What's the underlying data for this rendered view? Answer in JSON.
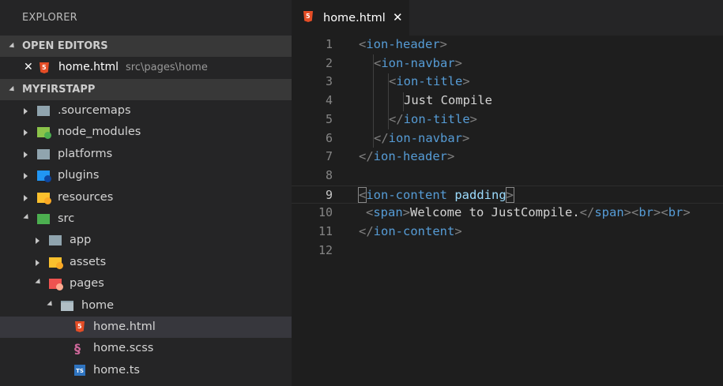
{
  "sidebar": {
    "title": "EXPLORER",
    "open_editors": {
      "header": "OPEN EDITORS",
      "items": [
        {
          "name": "home.html",
          "desc": "src\\pages\\home",
          "icon": "html5-icon"
        }
      ]
    },
    "project": {
      "header": "MYFIRSTAPP",
      "items": [
        {
          "label": ".sourcemaps",
          "icon": "folder-icon"
        },
        {
          "label": "node_modules",
          "icon": "node-folder-icon"
        },
        {
          "label": "platforms",
          "icon": "folder-icon"
        },
        {
          "label": "plugins",
          "icon": "plugin-folder-icon"
        },
        {
          "label": "resources",
          "icon": "resources-folder-icon"
        },
        {
          "label": "src",
          "icon": "src-folder-icon"
        },
        {
          "label": "app",
          "icon": "folder-icon"
        },
        {
          "label": "assets",
          "icon": "assets-folder-icon"
        },
        {
          "label": "pages",
          "icon": "pages-folder-icon"
        },
        {
          "label": "home",
          "icon": "open-folder-icon"
        },
        {
          "label": "home.html",
          "icon": "html5-icon"
        },
        {
          "label": "home.scss",
          "icon": "sass-icon"
        },
        {
          "label": "home.ts",
          "icon": "typescript-icon"
        }
      ]
    }
  },
  "tab": {
    "label": "home.html",
    "close": "✕"
  },
  "editor": {
    "current_line": 9,
    "line_numbers": [
      "1",
      "2",
      "3",
      "4",
      "5",
      "6",
      "7",
      "8",
      "9",
      "10",
      "11",
      "12"
    ],
    "lines": {
      "l1": {
        "lt": "<",
        "tag": "ion-header",
        "gt": ">"
      },
      "l2": {
        "lt": "<",
        "tag": "ion-navbar",
        "gt": ">"
      },
      "l3": {
        "lt": "<",
        "tag": "ion-title",
        "gt": ">"
      },
      "l4": {
        "text": "Just Compile"
      },
      "l5": {
        "lt": "</",
        "tag": "ion-title",
        "gt": ">"
      },
      "l6": {
        "lt": "</",
        "tag": "ion-navbar",
        "gt": ">"
      },
      "l7": {
        "lt": "</",
        "tag": "ion-header",
        "gt": ">"
      },
      "l9": {
        "lt": "<",
        "tag": "ion-content",
        "attr": "padding",
        "gt": ">"
      },
      "l10": {
        "lt1": "<",
        "tag1": "span",
        "gt1": ">",
        "text": "Welcome to JustCompile.",
        "lt2": "</",
        "tag2": "span",
        "gt2": ">",
        "lt3": "<",
        "tag3": "br",
        "gt3": ">",
        "lt4": "<",
        "tag4": "br",
        "gt4": ">"
      },
      "l11": {
        "lt": "</",
        "tag": "ion-content",
        "gt": ">"
      }
    }
  },
  "colors": {
    "tag": "#569cd6",
    "punct": "#808080",
    "attr": "#9cdcfe",
    "text": "#d4d4d4",
    "html5": "#e44d26",
    "typescript": "#2f74c0",
    "sass": "#cd6799"
  }
}
